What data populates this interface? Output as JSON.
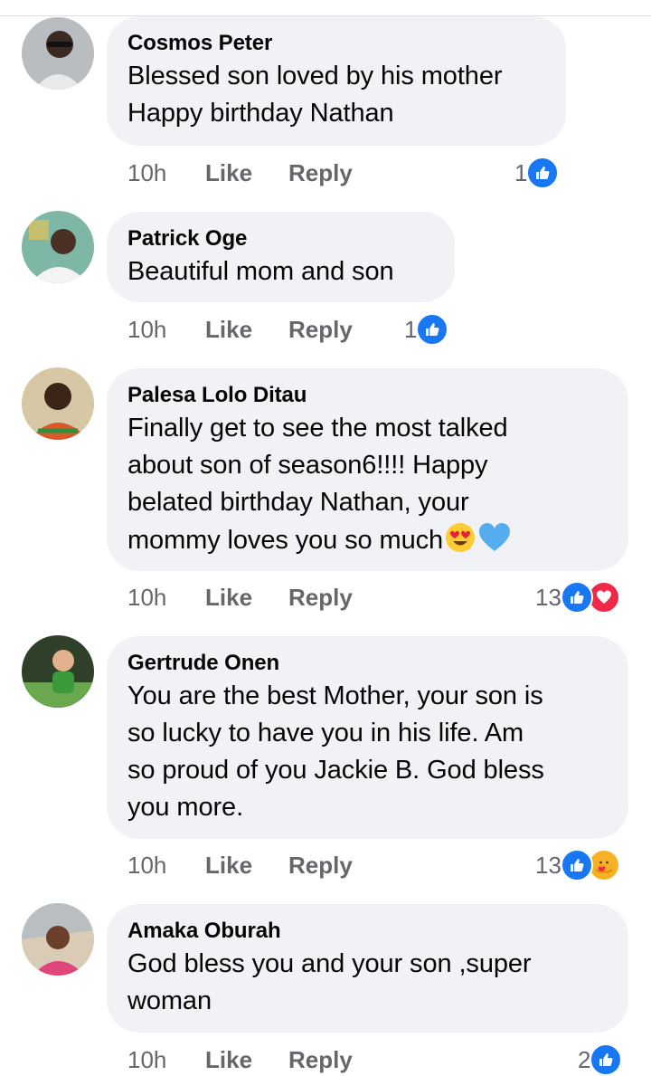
{
  "colors": {
    "bubble": "#f0f2f5",
    "meta": "#65676b",
    "like_blue": "#1877f2",
    "love_red": "#f02849",
    "care_yellow": "#f7b125"
  },
  "comments": [
    {
      "author": "Cosmos Peter",
      "lines": [
        "Blessed son loved by his mother",
        "Happy birthday Nathan"
      ],
      "time": "10h",
      "like": "Like",
      "reply": "Reply",
      "reaction_count": "1",
      "reactions": [
        "like-icon"
      ]
    },
    {
      "author": "Patrick Oge",
      "lines": [
        "Beautiful mom and son"
      ],
      "time": "10h",
      "like": "Like",
      "reply": "Reply",
      "reaction_count": "1",
      "reactions": [
        "like-icon"
      ]
    },
    {
      "author": "Palesa Lolo Ditau",
      "lines": [
        "Finally get to see the most talked",
        "about son of season6!!!! Happy",
        "belated birthday Nathan, your",
        "mommy loves you so much"
      ],
      "emojis": [
        "heart-eyes-emoji",
        "blue-heart-emoji"
      ],
      "time": "10h",
      "like": "Like",
      "reply": "Reply",
      "reaction_count": "13",
      "reactions": [
        "like-icon",
        "love-icon"
      ]
    },
    {
      "author": "Gertrude Onen",
      "lines": [
        "You are the best Mother,  your son is",
        "so  lucky to have you in his life. Am",
        "so proud of you Jackie B. God bless",
        "you more."
      ],
      "time": "10h",
      "like": "Like",
      "reply": "Reply",
      "reaction_count": "13",
      "reactions": [
        "like-icon",
        "care-icon"
      ]
    },
    {
      "author": "Amaka Oburah",
      "lines": [
        "God bless you and your son ,super",
        "woman"
      ],
      "time": "10h",
      "like": "Like",
      "reply": "Reply",
      "reaction_count": "2",
      "reactions": [
        "like-icon"
      ]
    }
  ]
}
